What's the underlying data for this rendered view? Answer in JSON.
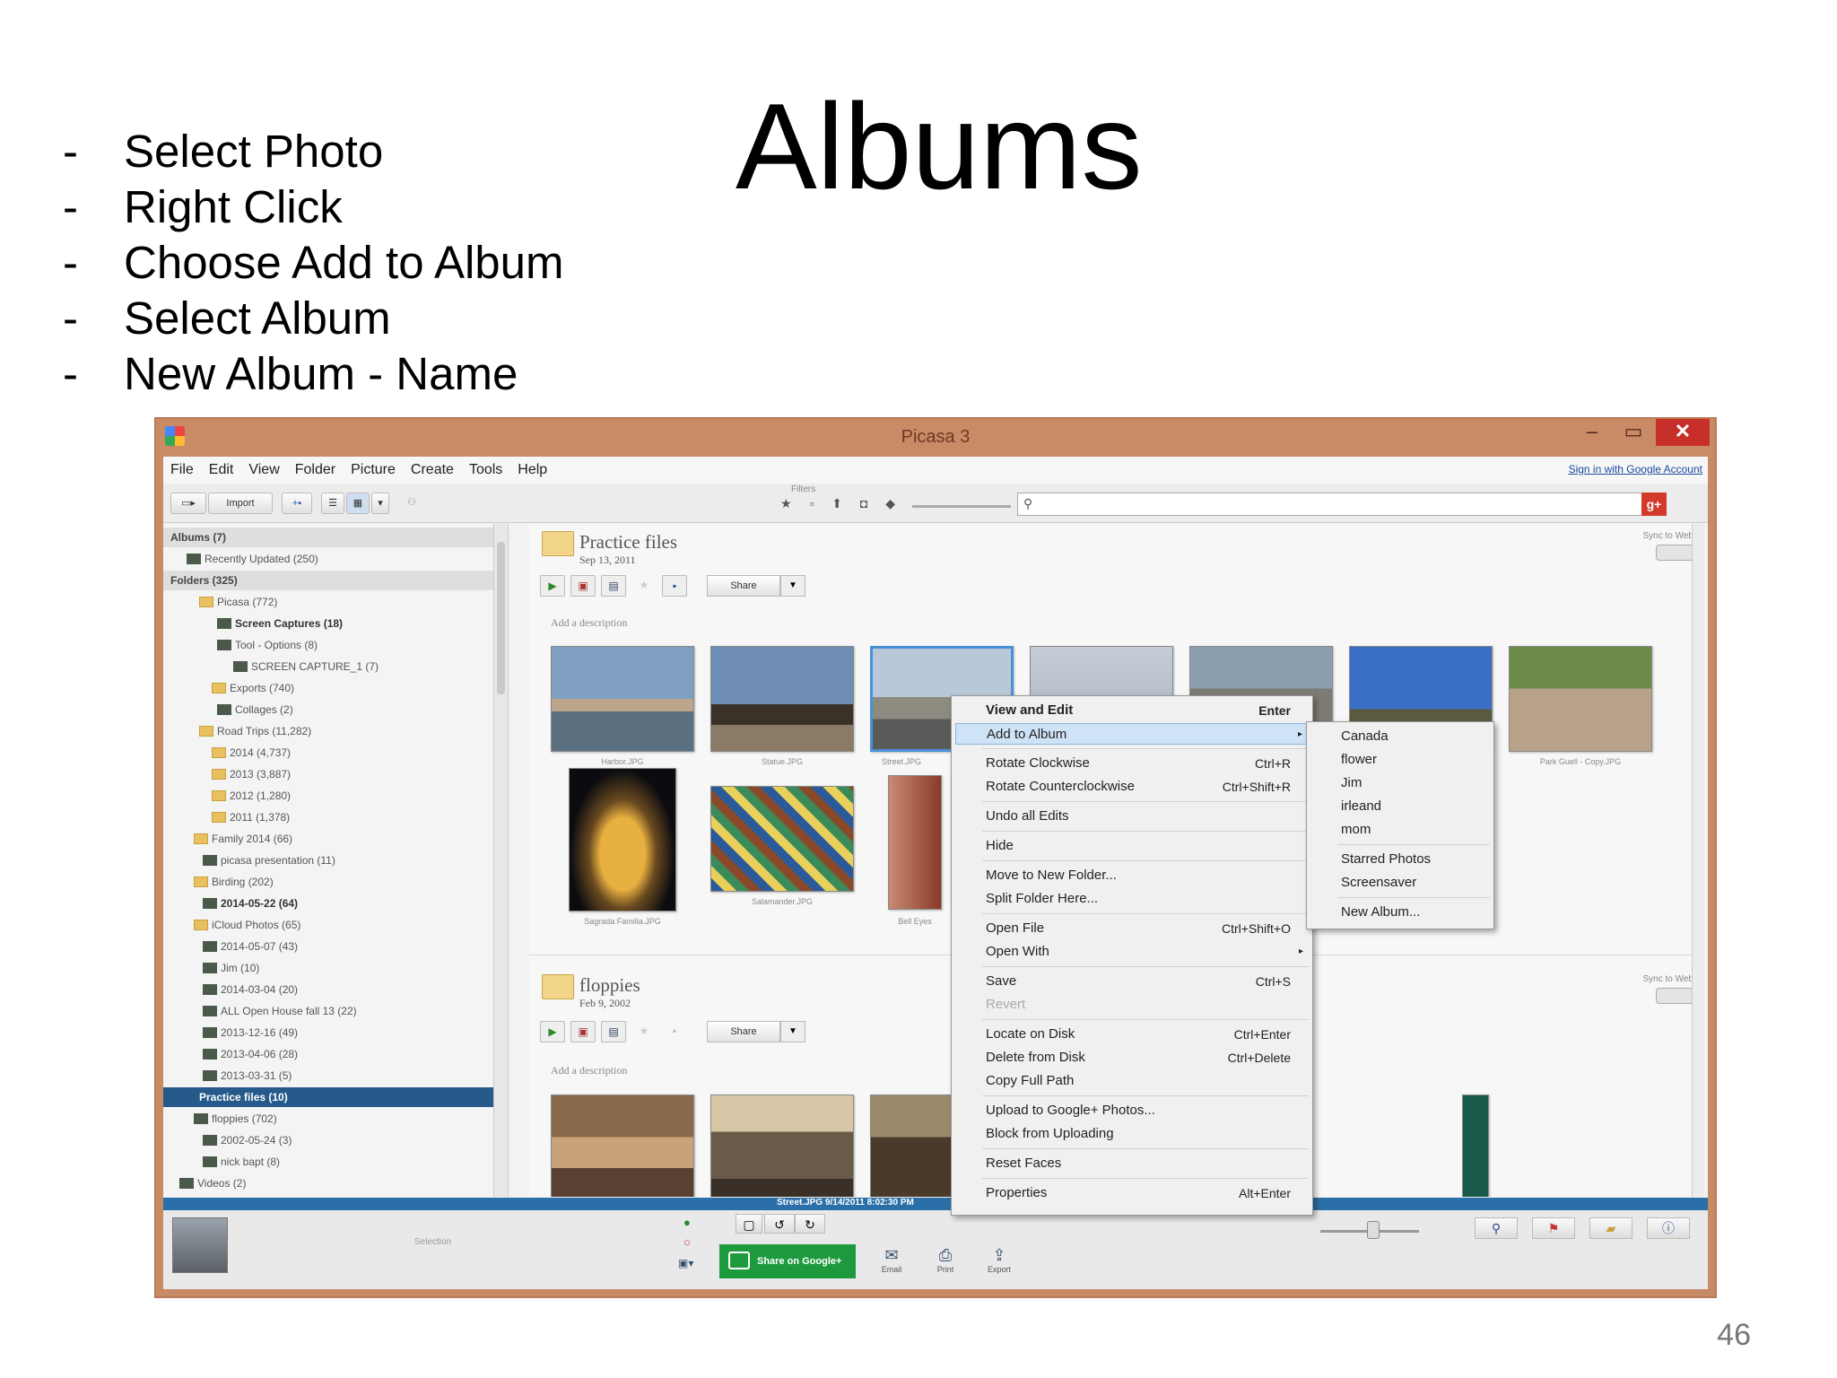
{
  "slide": {
    "title": "Albums",
    "bullets": [
      "Select Photo",
      "Right Click",
      "Choose Add to Album",
      "Select Album",
      "New Album - Name"
    ],
    "dash": "-",
    "page_number": "46"
  },
  "window": {
    "title": "Picasa 3",
    "min_glyph": "–",
    "max_glyph": "▭",
    "close_glyph": "✕"
  },
  "menubar": {
    "items": [
      "File",
      "Edit",
      "View",
      "Folder",
      "Picture",
      "Create",
      "Tools",
      "Help"
    ],
    "sign_in": "Sign in with Google Account"
  },
  "toolbar": {
    "import_label": "Import",
    "filters_label": "Filters",
    "filter_glyphs": "★ ▫ ⬆ ◘ ◆",
    "gplus": "g+"
  },
  "tree": {
    "rows": [
      {
        "text": "Albums (7)",
        "kind": "section"
      },
      {
        "text": "Recently Updated (250)",
        "kind": "plain"
      },
      {
        "text": "Folders (325)",
        "kind": "section"
      },
      {
        "text": "Picasa (772)",
        "kind": "folder"
      },
      {
        "text": "Screen Captures (18)",
        "kind": "bold"
      },
      {
        "text": "Tool - Options (8)",
        "kind": "plain"
      },
      {
        "text": "SCREEN CAPTURE_1 (7)",
        "kind": "plain"
      },
      {
        "text": "Exports (740)",
        "kind": "folder"
      },
      {
        "text": "Collages (2)",
        "kind": "thumb"
      },
      {
        "text": "Road Trips (11,282)",
        "kind": "folder"
      },
      {
        "text": "2014 (4,737)",
        "kind": "folder"
      },
      {
        "text": "2013 (3,887)",
        "kind": "folder"
      },
      {
        "text": "2012 (1,280)",
        "kind": "folder"
      },
      {
        "text": "2011 (1,378)",
        "kind": "folder"
      },
      {
        "text": "Family 2014 (66)",
        "kind": "folder"
      },
      {
        "text": "picasa presentation (11)",
        "kind": "thumb"
      },
      {
        "text": "Birding (202)",
        "kind": "folder"
      },
      {
        "text": "2014-05-22 (64)",
        "kind": "thumb-bold"
      },
      {
        "text": "iCloud Photos (65)",
        "kind": "folder"
      },
      {
        "text": "2014-05-07 (43)",
        "kind": "thumb"
      },
      {
        "text": "Jim (10)",
        "kind": "thumb"
      },
      {
        "text": "2014-03-04 (20)",
        "kind": "thumb"
      },
      {
        "text": "ALL Open House fall 13 (22)",
        "kind": "thumb"
      },
      {
        "text": "2013-12-16 (49)",
        "kind": "thumb"
      },
      {
        "text": "2013-04-06 (28)",
        "kind": "thumb"
      },
      {
        "text": "2013-03-31 (5)",
        "kind": "thumb"
      },
      {
        "text": "Practice files (10)",
        "kind": "selected"
      },
      {
        "text": "floppies (702)",
        "kind": "thumb"
      },
      {
        "text": "2002-05-24 (3)",
        "kind": "thumb"
      },
      {
        "text": "nick bapt (8)",
        "kind": "thumb"
      },
      {
        "text": "Videos (2)",
        "kind": "thumb"
      }
    ]
  },
  "main": {
    "folder1": {
      "name": "Practice files",
      "date": "Sep 13, 2011",
      "add_desc": "Add a description",
      "share": "Share"
    },
    "folder2": {
      "name": "floppies",
      "date": "Feb 9, 2002",
      "add_desc": "Add a description",
      "share": "Share"
    },
    "sync_label": "Sync to Web",
    "captions": [
      "Harbor.JPG",
      "Statue.JPG",
      "Street.JPG",
      "Park Guell - Copy.JPG",
      "Sagrada Familia.JPG",
      "Salamander.JPG",
      "Bell Eyes"
    ]
  },
  "status": {
    "text": "Street.JPG     9/14/2011 8:02:30 PM"
  },
  "bottom": {
    "selection_label": "Selection",
    "share_google": "Share on Google+",
    "tools": [
      {
        "icon": "✉",
        "label": "Email"
      },
      {
        "icon": "⎙",
        "label": "Print"
      },
      {
        "icon": "⇪",
        "label": "Export"
      }
    ]
  },
  "context_menu": {
    "items": [
      {
        "label": "View and Edit",
        "shortcut": "Enter",
        "style": "bold"
      },
      {
        "label": "Add to Album",
        "shortcut": "",
        "style": "hl",
        "submenu": true
      },
      {
        "label": "Rotate Clockwise",
        "shortcut": "Ctrl+R"
      },
      {
        "label": "Rotate Counterclockwise",
        "shortcut": "Ctrl+Shift+R"
      },
      {
        "label": "Undo all Edits",
        "shortcut": ""
      },
      {
        "label": "Hide",
        "shortcut": ""
      },
      {
        "label": "Move to New Folder...",
        "shortcut": ""
      },
      {
        "label": "Split Folder Here...",
        "shortcut": ""
      },
      {
        "label": "Open File",
        "shortcut": "Ctrl+Shift+O"
      },
      {
        "label": "Open With",
        "shortcut": "",
        "submenu": true
      },
      {
        "label": "Save",
        "shortcut": "Ctrl+S"
      },
      {
        "label": "Revert",
        "shortcut": "",
        "style": "dis"
      },
      {
        "label": "Locate on Disk",
        "shortcut": "Ctrl+Enter"
      },
      {
        "label": "Delete from Disk",
        "shortcut": "Ctrl+Delete"
      },
      {
        "label": "Copy Full Path",
        "shortcut": ""
      },
      {
        "label": "Upload to Google+ Photos...",
        "shortcut": ""
      },
      {
        "label": "Block from Uploading",
        "shortcut": ""
      },
      {
        "label": "Reset Faces",
        "shortcut": ""
      },
      {
        "label": "Properties",
        "shortcut": "Alt+Enter"
      }
    ]
  },
  "album_submenu": {
    "items": [
      "Canada",
      "flower",
      "Jim",
      "irleand",
      "mom",
      "Starred Photos",
      "Screensaver",
      "New Album..."
    ]
  }
}
